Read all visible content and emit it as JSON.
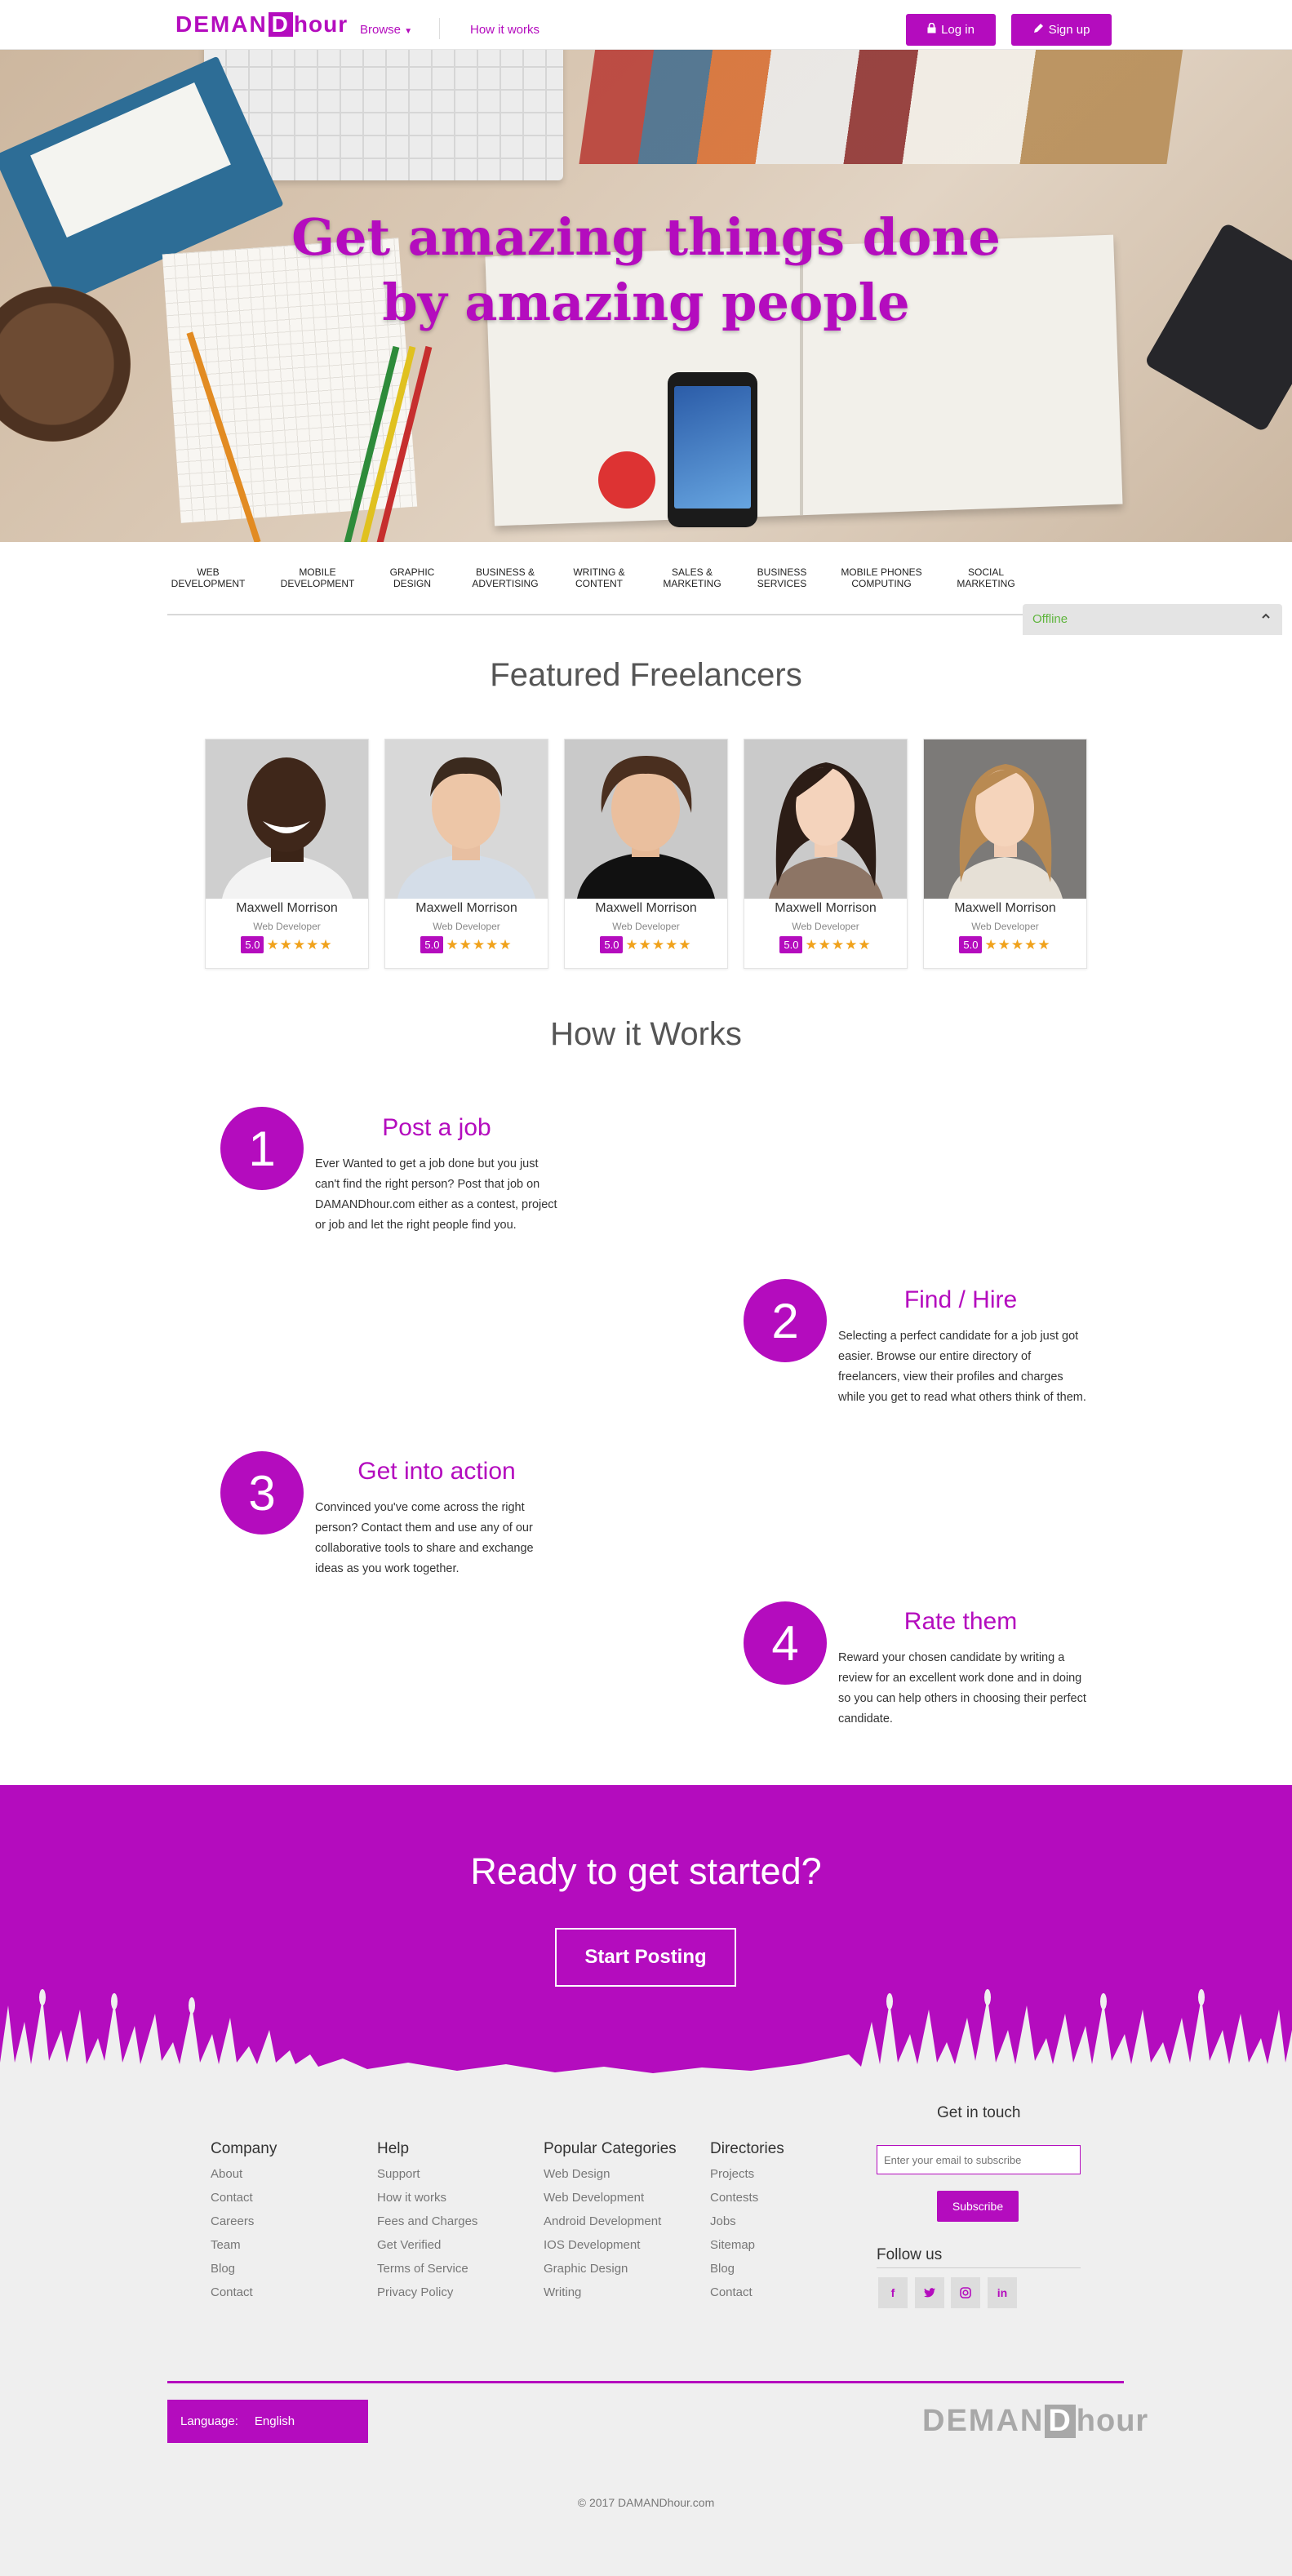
{
  "nav": {
    "logo_part1": "DEMAN",
    "logo_d": "D",
    "logo_part2": "hour",
    "browse": "Browse",
    "how_it_works": "How it works",
    "login": "Log in",
    "signup": "Sign up"
  },
  "hero": {
    "title_line1": "Get amazing things done",
    "title_line2": "by amazing people"
  },
  "categories": [
    [
      "WEB",
      "DEVELOPMENT"
    ],
    [
      "MOBILE",
      "DEVELOPMENT"
    ],
    [
      "GRAPHIC",
      "DESIGN"
    ],
    [
      "BUSINESS &",
      "ADVERTISING"
    ],
    [
      "WRITING &",
      "CONTENT"
    ],
    [
      "SALES &",
      "MARKETING"
    ],
    [
      "BUSINESS",
      "SERVICES"
    ],
    [
      "MOBILE PHONES",
      "COMPUTING"
    ],
    [
      "SOCIAL",
      "MARKETING"
    ]
  ],
  "chat": {
    "status": "Offline"
  },
  "featured": {
    "title": "Featured Freelancers",
    "cards": [
      {
        "name": "Maxwell Morrison",
        "role": "Web Developer",
        "rating": "5.0",
        "stars": "★★★★★"
      },
      {
        "name": "Maxwell Morrison",
        "role": "Web Developer",
        "rating": "5.0",
        "stars": "★★★★★"
      },
      {
        "name": "Maxwell Morrison",
        "role": "Web Developer",
        "rating": "5.0",
        "stars": "★★★★★"
      },
      {
        "name": "Maxwell Morrison",
        "role": "Web Developer",
        "rating": "5.0",
        "stars": "★★★★★"
      },
      {
        "name": "Maxwell Morrison",
        "role": "Web Developer",
        "rating": "5.0",
        "stars": "★★★★★"
      }
    ]
  },
  "how": {
    "title": "How it Works",
    "steps": [
      {
        "num": "1",
        "title": "Post a job",
        "text": "Ever Wanted to get a job done but you just can't find the right person? Post that job on DAMANDhour.com either as a contest, project or job and let the right people find you."
      },
      {
        "num": "2",
        "title": "Find / Hire",
        "text": "Selecting a perfect candidate for a job just got easier. Browse our entire directory of freelancers, view their profiles and charges while you get to read what others think of them."
      },
      {
        "num": "3",
        "title": "Get into action",
        "text": "Convinced you've come across the right person? Contact them and use any of our collaborative tools to share and exchange ideas as you work together."
      },
      {
        "num": "4",
        "title": "Rate them",
        "text": "Reward your chosen candidate by writing a review for an excellent work done and in doing so you can help others in choosing their perfect candidate."
      }
    ]
  },
  "cta": {
    "title": "Ready to get started?",
    "button": "Start Posting"
  },
  "footer": {
    "columns": [
      {
        "title": "Company",
        "links": [
          "About",
          "Contact",
          "Careers",
          "Team",
          "Blog",
          "Contact"
        ]
      },
      {
        "title": "Help",
        "links": [
          "Support",
          "How it works",
          "Fees and Charges",
          "Get Verified",
          "Terms of Service",
          "Privacy Policy"
        ]
      },
      {
        "title": "Popular Categories",
        "links": [
          "Web Design",
          "Web Development",
          "Android Development",
          "IOS Development",
          "Graphic Design",
          "Writing"
        ]
      },
      {
        "title": "Directories",
        "links": [
          "Projects",
          "Contests",
          "Jobs",
          "Sitemap",
          "Blog",
          "Contact"
        ]
      }
    ],
    "get_in_touch": "Get in touch",
    "email_placeholder": "Enter your email to subscribe",
    "subscribe": "Subscribe",
    "follow_us": "Follow us",
    "social": [
      {
        "icon": "facebook-icon",
        "glyph": "f"
      },
      {
        "icon": "twitter-icon",
        "glyph": "t"
      },
      {
        "icon": "instagram-icon",
        "glyph": "◎"
      },
      {
        "icon": "linkedin-icon",
        "glyph": "in"
      }
    ],
    "language_label": "Language:",
    "language_value": "English",
    "copyright": "© 2017 DAMANDhour.com"
  },
  "colors": {
    "brand": "#b40cbe",
    "star": "#f0a21c",
    "offline": "#5fb53d"
  }
}
